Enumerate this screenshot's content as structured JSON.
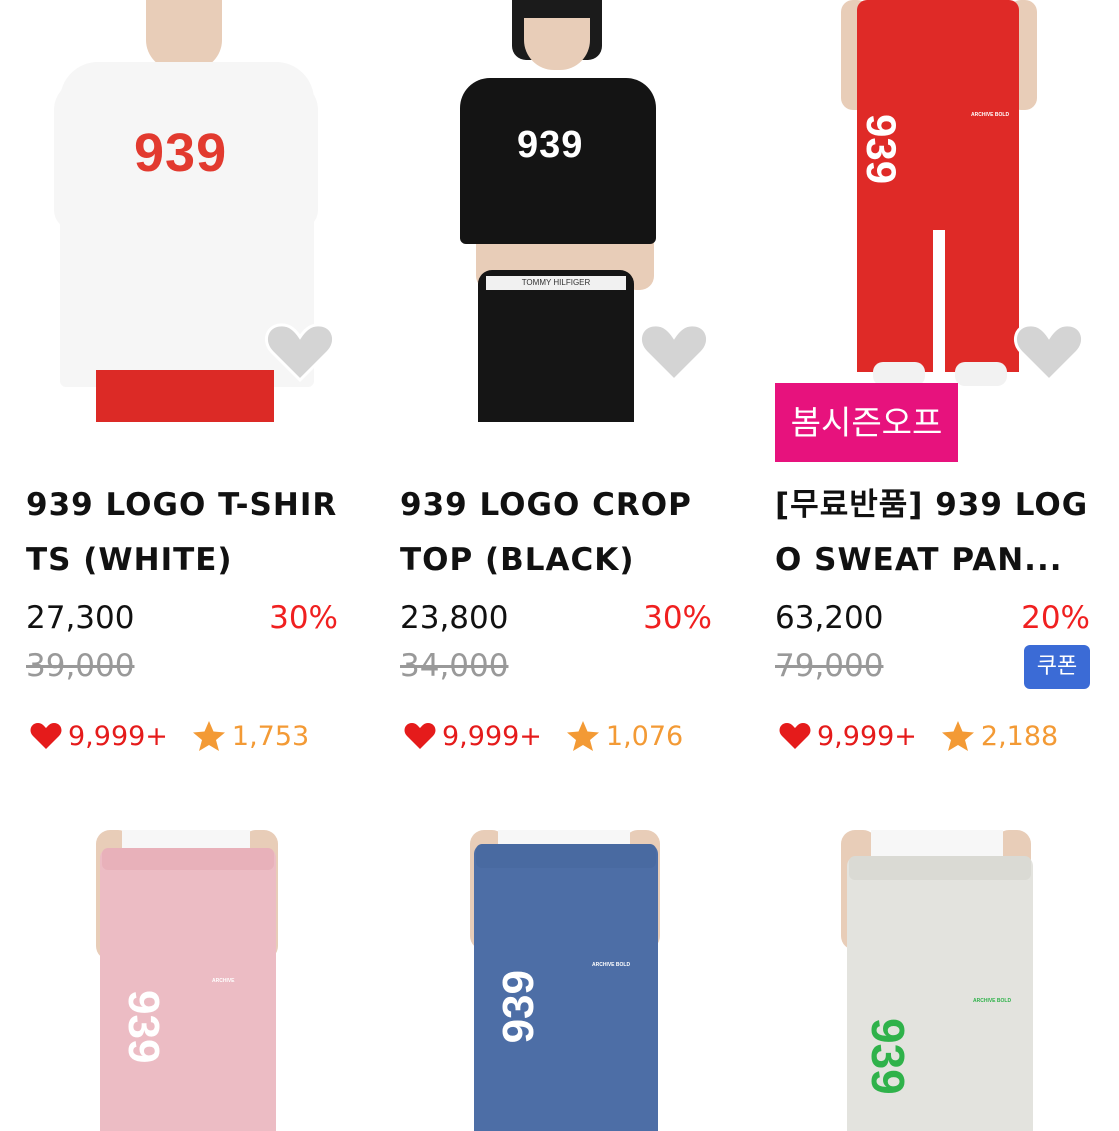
{
  "products": [
    {
      "title": "939 LOGO T-SHIRTS (WHITE)",
      "price": "27,300",
      "discount": "30%",
      "original_price": "39,000",
      "likes": "9,999+",
      "rating": "1,753",
      "print": "939",
      "colors": {
        "garment": "#f6f6f6",
        "print": "#e23a2f"
      }
    },
    {
      "title": "939 LOGO CROP TOP (BLACK)",
      "price": "23,800",
      "discount": "30%",
      "original_price": "34,000",
      "likes": "9,999+",
      "rating": "1,076",
      "print": "939",
      "waistband_text": "TOMMY HILFIGER",
      "colors": {
        "garment": "#141414",
        "print": "#ffffff"
      }
    },
    {
      "title": "[무료반품] 939 LOGO SWEAT PAN...",
      "price": "63,200",
      "discount": "20%",
      "original_price": "79,000",
      "likes": "9,999+",
      "rating": "2,188",
      "badge": "봄시즌오프",
      "coupon": "쿠폰",
      "print": "939",
      "print_text": "ARCHIVE BOLD",
      "colors": {
        "garment": "#df2a27",
        "print": "#ffffff"
      }
    },
    {
      "print": "939",
      "print_text": "ARCHIVE",
      "colors": {
        "garment": "#ecbcc4",
        "print": "#ffffff"
      }
    },
    {
      "print": "939",
      "print_text": "ARCHIVE BOLD",
      "colors": {
        "garment": "#4d6ea6",
        "print": "#ffffff"
      }
    },
    {
      "print": "939",
      "print_text": "ARCHIVE BOLD",
      "colors": {
        "garment": "#e3e3de",
        "print": "#2fb24a"
      }
    }
  ],
  "icons": {
    "wishlist": "heart-outline-icon",
    "likes": "heart-icon",
    "rating": "star-icon"
  },
  "theme": {
    "like_red": "#e51b1b",
    "discount_red": "#f02020",
    "star_orange": "#f39a35",
    "badge_pink": "#e7127d",
    "coupon_blue": "#3b6bd6"
  }
}
